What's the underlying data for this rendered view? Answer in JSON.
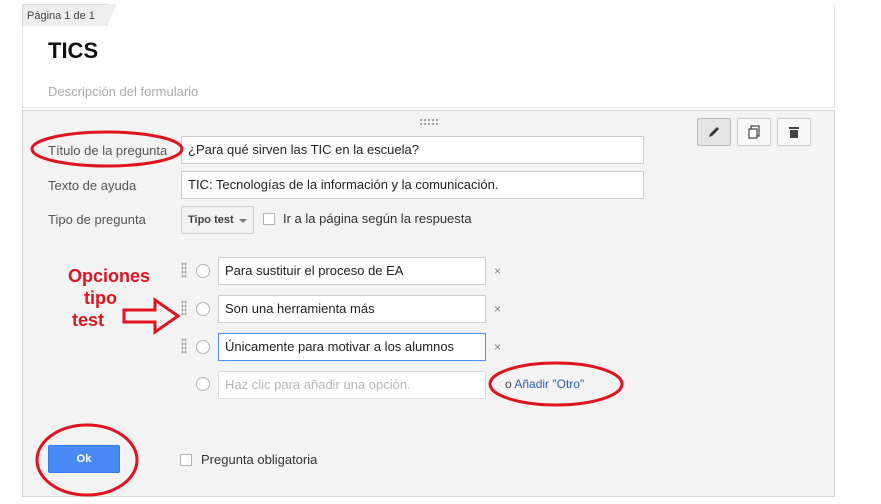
{
  "page_indicator": "Página 1 de 1",
  "form": {
    "title": "TICS",
    "description_placeholder": "Descripción del formulario"
  },
  "toolbar": {
    "edit_icon": "pencil-icon",
    "duplicate_icon": "duplicate-icon",
    "delete_icon": "trash-icon"
  },
  "question": {
    "title_label": "Título de la pregunta",
    "title_value": "¿Para qué sirven las TIC en la escuela?",
    "help_label": "Texto de ayuda",
    "help_value": "TIC: Tecnologías de la información y la comunicación.",
    "type_label": "Tipo de pregunta",
    "type_value": "Tipo test",
    "go_to_page_label": "Ir a la página según la respuesta",
    "options": [
      {
        "value": "Para sustituir el proceso de EA"
      },
      {
        "value": "Son una herramienta más"
      },
      {
        "value": "Únicamente para motivar a los alumnos"
      }
    ],
    "add_option_placeholder": "Haz clic para añadir una opción.",
    "remove_symbol": "×",
    "or_text": "o",
    "add_other_label": "Añadir \"Otro\"",
    "required_label": "Pregunta obligatoria",
    "ok_label": "Ok"
  },
  "annotation": {
    "line1": "Opciones",
    "line2": "tipo",
    "line3": "test",
    "color": "#e0141e"
  },
  "colors": {
    "accent_blue": "#4a8af4",
    "link_blue": "#2a5db0",
    "edit_bg": "#f3f3f3"
  }
}
